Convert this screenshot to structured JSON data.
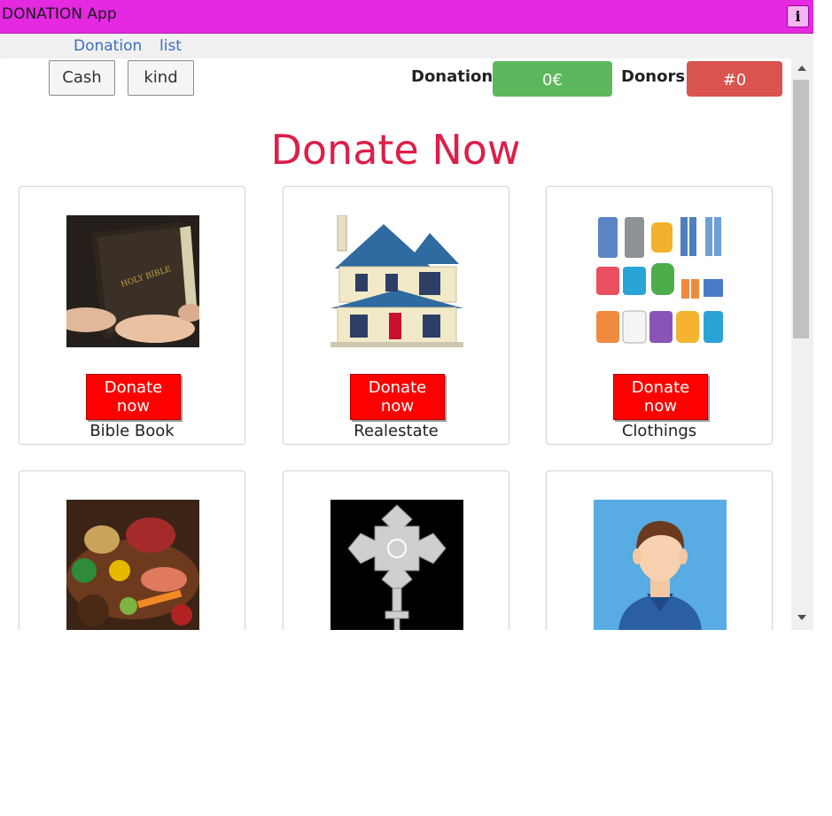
{
  "window": {
    "title": "DONATION App",
    "info_label": "i"
  },
  "nav": {
    "links": [
      "Donation",
      "list"
    ]
  },
  "toolbar": {
    "cash_label": "Cash",
    "kind_label": "kind"
  },
  "stats": {
    "donation_label": "Donation:",
    "donation_value": "0€",
    "donors_label": "Donors:",
    "donors_value": "#0",
    "donation_color": "#5cb85c",
    "donors_color": "#d9534f"
  },
  "headline": "Donate Now",
  "cards": [
    {
      "label": "Bible Book",
      "button": "Donate now",
      "icon": "bible-icon"
    },
    {
      "label": "Realestate",
      "button": "Donate now",
      "icon": "house-icon"
    },
    {
      "label": "Clothings",
      "button": "Donate now",
      "icon": "clothes-icon"
    },
    {
      "label": "",
      "button": "",
      "icon": "food-icon"
    },
    {
      "label": "",
      "button": "",
      "icon": "cross-icon"
    },
    {
      "label": "",
      "button": "",
      "icon": "person-icon"
    }
  ]
}
